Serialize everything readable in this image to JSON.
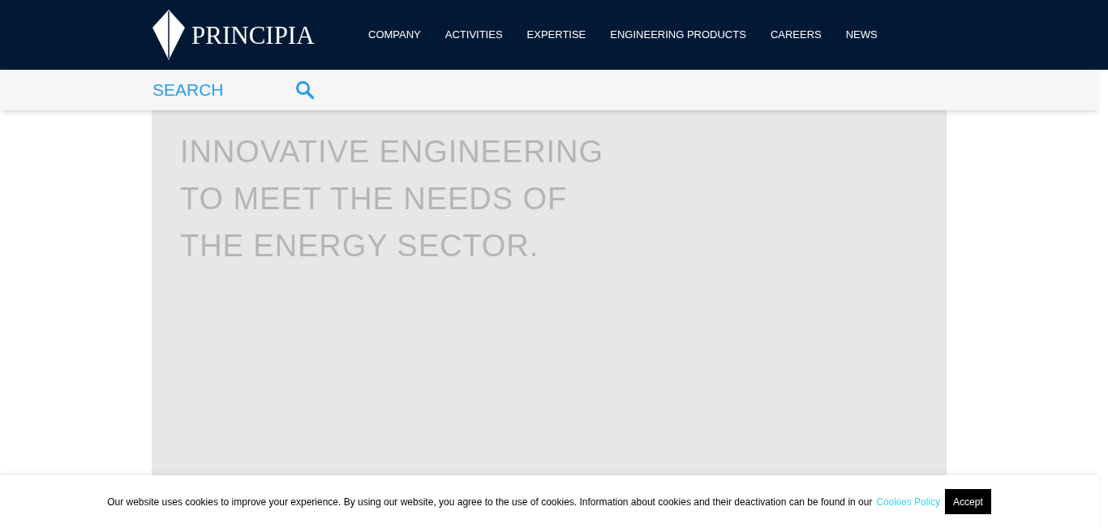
{
  "header": {
    "logo_text": "PRINCIPIA",
    "nav": [
      {
        "label": "COMPANY"
      },
      {
        "label": "ACTIVITIES"
      },
      {
        "label": "EXPERTISE"
      },
      {
        "label": "ENGINEERING PRODUCTS"
      },
      {
        "label": "CAREERS"
      },
      {
        "label": "NEWS"
      }
    ]
  },
  "search": {
    "placeholder": "SEARCH"
  },
  "hero": {
    "headline_lines": [
      "INNOVATIVE ENGINEERING",
      "TO MEET THE NEEDS OF",
      "THE ENERGY SECTOR."
    ]
  },
  "cookie_banner": {
    "text": "Our website uses cookies to improve your experience. By using our website, you agree to the use of cookies. Information about cookies and their deactivation can be found in our",
    "link": "Cookies Policy",
    "button": "Accept"
  }
}
